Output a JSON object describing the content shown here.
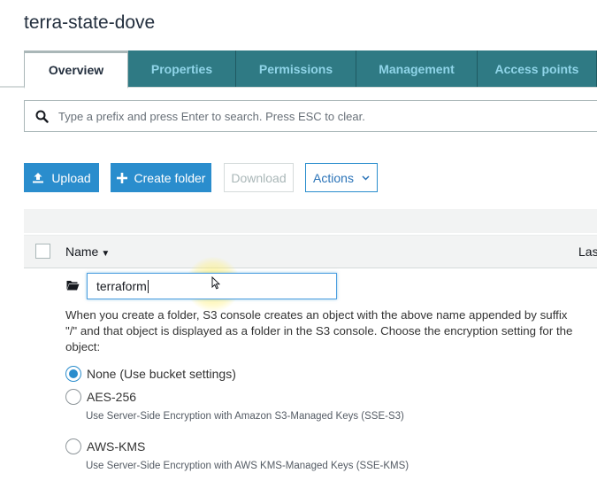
{
  "bucket": {
    "title": "terra-state-dove"
  },
  "tabs": [
    {
      "label": "Overview",
      "active": true
    },
    {
      "label": "Properties",
      "active": false
    },
    {
      "label": "Permissions",
      "active": false
    },
    {
      "label": "Management",
      "active": false
    },
    {
      "label": "Access points",
      "active": false
    }
  ],
  "search": {
    "placeholder": "Type a prefix and press Enter to search. Press ESC to clear."
  },
  "toolbar": {
    "upload_label": "Upload",
    "create_folder_label": "Create folder",
    "download_label": "Download",
    "actions_label": "Actions"
  },
  "table": {
    "name_header": "Name",
    "last_header": "Las"
  },
  "new_folder": {
    "value": "terraform",
    "help_text": "When you create a folder, S3 console creates an object with the above name appended by suffix \"/\" and that object is displayed as a folder in the S3 console. Choose the encryption setting for the object:",
    "options": [
      {
        "label": "None (Use bucket settings)",
        "description": "",
        "selected": true
      },
      {
        "label": "AES-256",
        "description": "Use Server-Side Encryption with Amazon S3-Managed Keys (SSE-S3)",
        "selected": false
      },
      {
        "label": "AWS-KMS",
        "description": "Use Server-Side Encryption with AWS KMS-Managed Keys (SSE-KMS)",
        "selected": false
      }
    ]
  },
  "colors": {
    "primary": "#2a8dcd",
    "tab_inactive_bg": "#2f7a84",
    "tab_inactive_text": "#8fd4e8"
  }
}
